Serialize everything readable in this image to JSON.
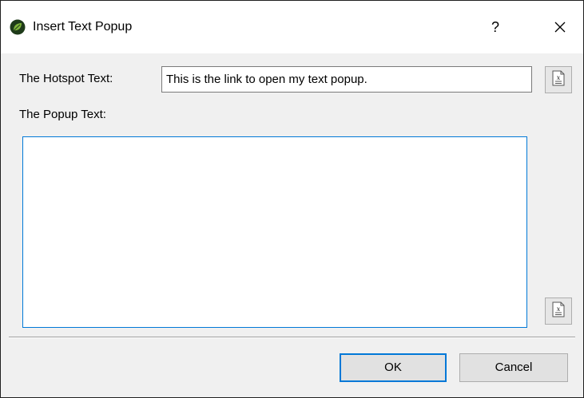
{
  "window": {
    "title": "Insert Text Popup",
    "help_glyph": "?",
    "close_icon": "close-icon",
    "app_icon": "leaf-logo-icon"
  },
  "form": {
    "hotspot_label": "The Hotspot Text:",
    "hotspot_value": "This is the link to open my text popup.",
    "popup_label": "The Popup Text:",
    "popup_value": "",
    "variable_button_icon": "insert-variable-icon"
  },
  "buttons": {
    "ok_label": "OK",
    "cancel_label": "Cancel"
  },
  "colors": {
    "accent": "#0078d7",
    "logo_green": "#6a9a2a",
    "logo_dark": "#1f3b1a"
  }
}
